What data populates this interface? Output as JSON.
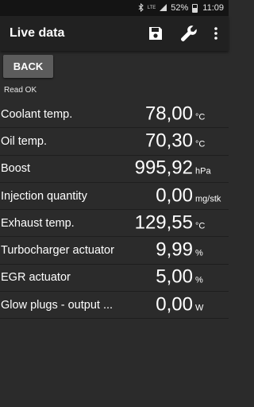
{
  "statusbar": {
    "icons": [
      "bluetooth-icon",
      "lte-signal-icon",
      "signal-icon",
      "battery-icon"
    ],
    "lte_label": "LTE",
    "battery": "52%",
    "time": "11:09"
  },
  "appbar": {
    "title": "Live data",
    "actions": [
      "save-icon",
      "wrench-icon",
      "overflow-menu-icon"
    ]
  },
  "back_label": "BACK",
  "status_text": "Read OK",
  "rows": [
    {
      "label": "Coolant temp.",
      "value": "78,00",
      "unit": "°C"
    },
    {
      "label": "Oil temp.",
      "value": "70,30",
      "unit": "°C"
    },
    {
      "label": "Boost",
      "value": "995,92",
      "unit": "hPa"
    },
    {
      "label": "Injection quantity",
      "value": "0,00",
      "unit": "mg/stk"
    },
    {
      "label": "Exhaust temp.",
      "value": "129,55",
      "unit": "°C"
    },
    {
      "label": "Turbocharger actuator",
      "value": "9,99",
      "unit": "%"
    },
    {
      "label": "EGR actuator",
      "value": "5,00",
      "unit": "%"
    },
    {
      "label": "Glow plugs - output ...",
      "value": "0,00",
      "unit": "W"
    }
  ],
  "colors": {
    "background": "#2b2b2b",
    "appbar": "#212121",
    "statusbar": "#141414",
    "button": "#5c5c5c",
    "text": "#ffffff"
  }
}
